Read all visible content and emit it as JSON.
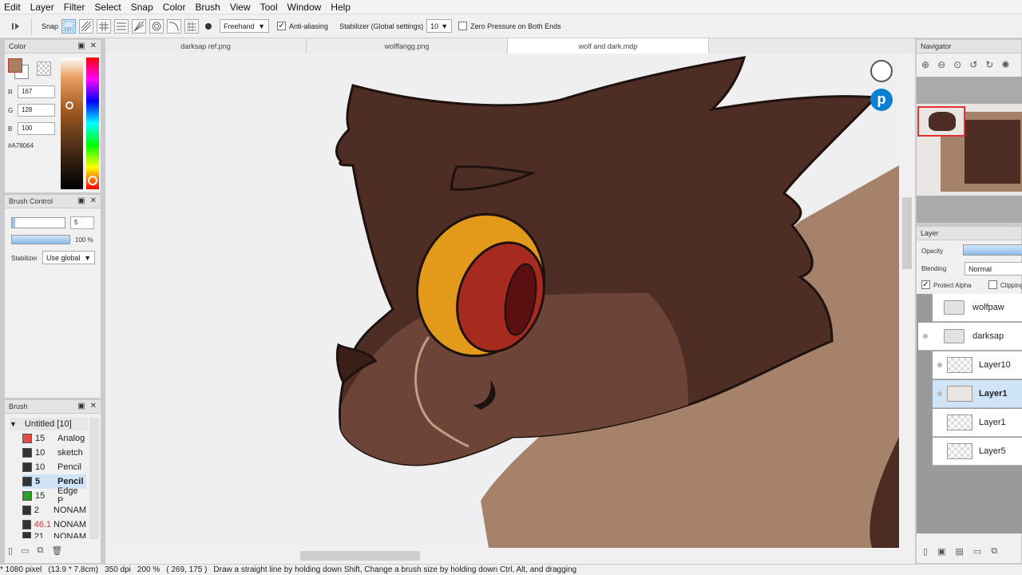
{
  "menu": [
    "Edit",
    "Layer",
    "Filter",
    "Select",
    "Snap",
    "Color",
    "Brush",
    "View",
    "Tool",
    "Window",
    "Help"
  ],
  "toolbar": {
    "snap_label": "Snap",
    "stroke_mode": "Freehand",
    "antialias_label": "Anti-aliasing",
    "stabilizer_label": "Stabilizer (Global settings)",
    "stabilizer_value": "10",
    "zero_pressure_label": "Zero Pressure on Both Ends"
  },
  "color_panel": {
    "title": "Color",
    "r_label": "R",
    "r": "167",
    "g_label": "G",
    "g": "128",
    "b_label": "B",
    "b": "100",
    "hex": "#A78064",
    "primary_color": "#a78064"
  },
  "brush_control": {
    "title": "Brush Control",
    "size": "5",
    "opacity": "100 %",
    "stabilizer_label": "Stabilizer",
    "stabilizer_value": "Use global"
  },
  "brush_panel": {
    "title": "Brush",
    "group": "Untitled [10]",
    "items": [
      {
        "size": "15",
        "name": "Analog",
        "color": "#e84848"
      },
      {
        "size": "10",
        "name": "sketch",
        "color": "#333333"
      },
      {
        "size": "10",
        "name": "Pencil",
        "color": "#333333"
      },
      {
        "size": "5",
        "name": "Pencil",
        "color": "#333333"
      },
      {
        "size": "15",
        "name": "Edge P",
        "color": "#2aa02a"
      },
      {
        "size": "2",
        "name": "NONAM",
        "color": "#333333"
      },
      {
        "size": "46.1",
        "name": "NONAM",
        "color": "#333333"
      },
      {
        "size": "21",
        "name": "NONAM",
        "color": "#333333"
      }
    ]
  },
  "tabs": [
    {
      "label": "darksap ref.png"
    },
    {
      "label": "wolffangg.png"
    },
    {
      "label": "wolf and dark.mdp"
    }
  ],
  "navigator": {
    "title": "Navigator"
  },
  "layer_panel": {
    "title": "Layer",
    "opacity_label": "Opacity",
    "blending_label": "Blending",
    "blending_value": "Normal",
    "protect_alpha_label": "Protect Alpha",
    "clipping_label": "Clipping",
    "layers": [
      {
        "name": "wolfpaw",
        "type": "folder"
      },
      {
        "name": "darksap",
        "type": "folder"
      },
      {
        "name": "Layer10",
        "type": "layer"
      },
      {
        "name": "Layer1",
        "type": "layer"
      },
      {
        "name": "Layer1",
        "type": "layer"
      },
      {
        "name": "Layer5",
        "type": "layer"
      }
    ]
  },
  "status": {
    "size": "* 1080 pixel",
    "dims": "(13.9 * 7.8cm)",
    "dpi": "350 dpi",
    "zoom": "200 %",
    "coords": "( 269, 175 )",
    "hint": "Draw a straight line by holding down Shift, Change a brush size by holding down Ctrl, Alt, and dragging"
  }
}
